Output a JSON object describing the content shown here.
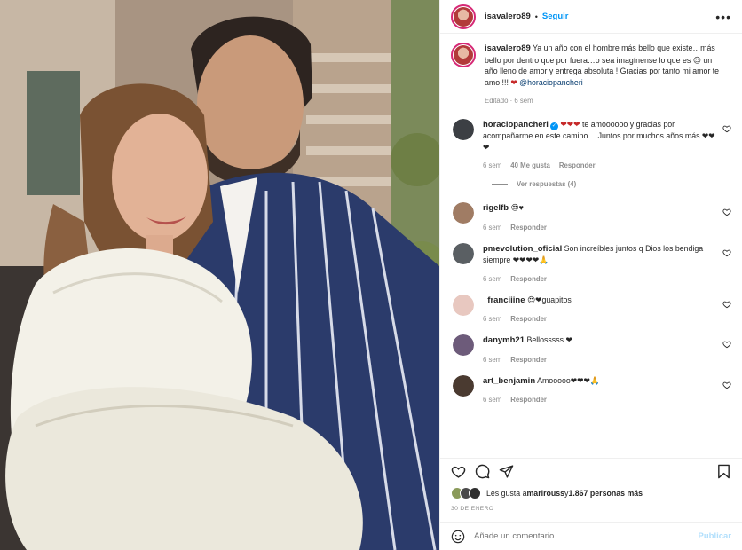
{
  "post": {
    "author": "isavalero89",
    "dot": "•",
    "follow_label": "Seguir",
    "more_label": "•••",
    "caption": {
      "text": "Ya un año con el hombre más bello que existe…más bello por dentro que por fuera…o sea imagínense lo que es 😍 un año lleno de amor y entrega absoluta ! Gracias por tanto mi amor te amo !!!",
      "heart": "❤",
      "mention": "@horaciopancheri",
      "meta": "Editado · 6 sem"
    }
  },
  "comments": [
    {
      "user": "horaciopancheri",
      "verified": true,
      "text_pre": "❤❤❤",
      "text": " te amoooooo y gracias por acompañarme en este camino… Juntos por muchos años más ❤❤❤",
      "time": "6 sem",
      "likes": "40 Me gusta",
      "reply": "Responder",
      "replies_label": "Ver respuestas (4)",
      "avatar_color": "#3c3f44"
    },
    {
      "user": "rigelfb",
      "text": "😍♥",
      "time": "6 sem",
      "reply": "Responder",
      "avatar_color": "#a07c64"
    },
    {
      "user": "pmevolution_oficial",
      "text": "Son increíbles juntos q Dios los bendiga siempre ❤❤❤❤🙏",
      "time": "6 sem",
      "reply": "Responder",
      "avatar_color": "#5a5f63"
    },
    {
      "user": "_franciiine",
      "text": "😍❤guapitos",
      "time": "6 sem",
      "reply": "Responder",
      "avatar_color": "#e8c8c0"
    },
    {
      "user": "danymh21",
      "text": "Bellosssss ❤",
      "time": "6 sem",
      "reply": "Responder",
      "avatar_color": "#6d5b7a"
    },
    {
      "user": "art_benjamin",
      "text": "Amooooo❤❤❤🙏",
      "time": "6 sem",
      "reply": "Responder",
      "avatar_color": "#4a3a30"
    }
  ],
  "likes": {
    "prefix": "Les gusta a ",
    "user": "marirouss",
    "middle": " y ",
    "count": "1.867 personas más"
  },
  "date": "30 DE ENERO",
  "add_comment": {
    "placeholder": "Añade un comentario...",
    "post_label": "Publicar"
  },
  "icons": {
    "like": "heart-outline-icon",
    "comment": "comment-bubble-icon",
    "share": "paper-plane-icon",
    "save": "bookmark-icon",
    "emoji": "smiley-icon",
    "more": "more-dots-icon"
  },
  "colors": {
    "accent": "#0095f6",
    "mention": "#00376b",
    "muted": "#8e8e8e",
    "text": "#262626",
    "story_ring": "#d62976"
  }
}
